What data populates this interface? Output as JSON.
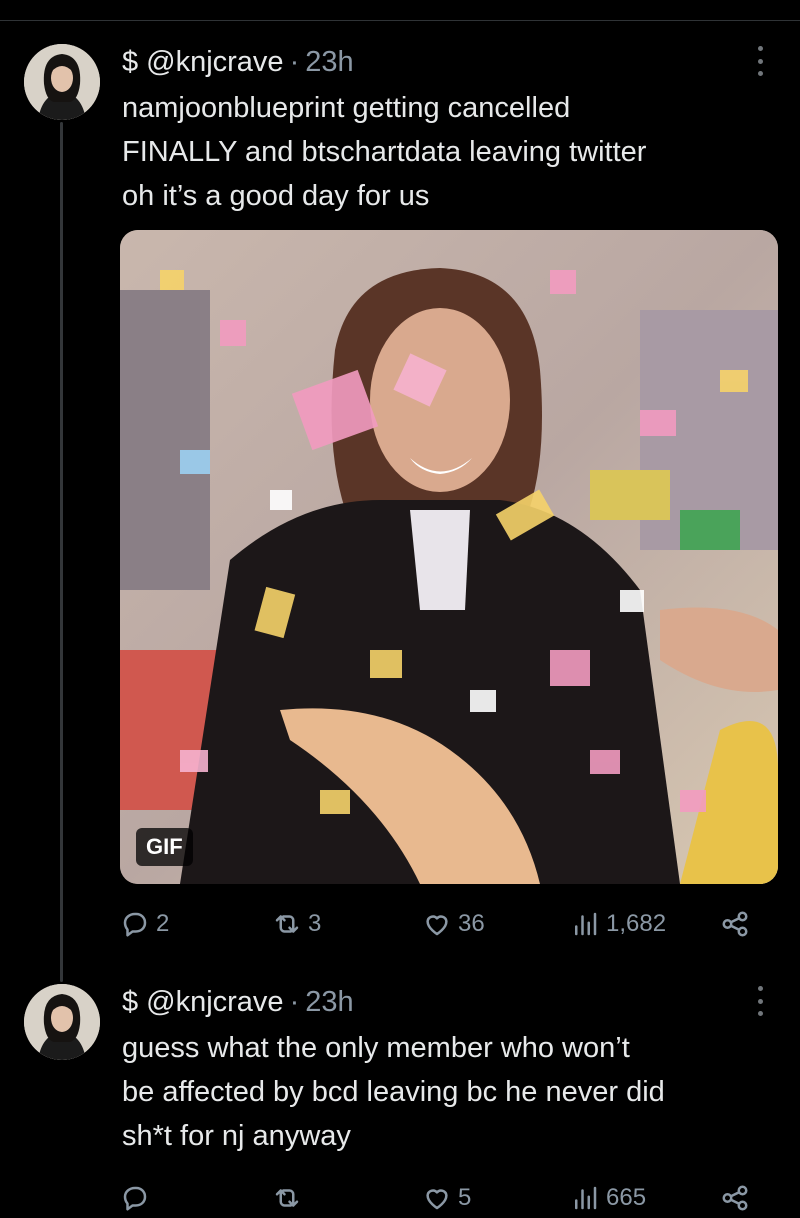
{
  "tweets": [
    {
      "display_name": "$",
      "handle": "@knjcrave",
      "separator": "·",
      "time": "23h",
      "lines": [
        "namjoonblueprint getting cancelled",
        "FINALLY and btschartdata leaving twitter",
        "oh it’s a good day for us"
      ],
      "media_badge": "GIF",
      "replies": "2",
      "reposts": "3",
      "likes": "36",
      "views": "1,682"
    },
    {
      "display_name": "$",
      "handle": "@knjcrave",
      "separator": "·",
      "time": "23h",
      "lines": [
        "guess what the only member who won’t",
        "be affected by bcd leaving bc he never did",
        "sh*t for nj anyway"
      ],
      "replies": "",
      "reposts": "",
      "likes": "5",
      "views": "665"
    }
  ],
  "icons": {
    "reply": "reply-icon",
    "repost": "repost-icon",
    "like": "heart-icon",
    "views": "views-icon",
    "share": "share-icon",
    "more": "more-icon"
  },
  "colors": {
    "background": "#000000",
    "text": "#e7e9ea",
    "muted": "#8b98a5",
    "divider": "#2f3336"
  }
}
